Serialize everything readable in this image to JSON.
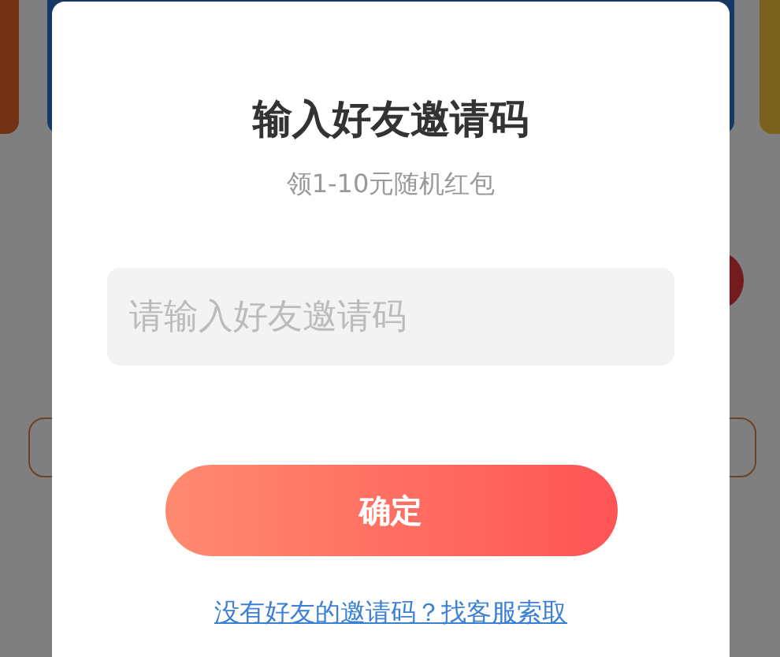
{
  "dialog": {
    "title": "输入好友邀请码",
    "subtitle": "领1-10元随机红包",
    "input": {
      "placeholder": "请输入好友邀请码"
    },
    "confirm_button": "确定",
    "help_link": "没有好友的邀请码？找客服索取"
  }
}
